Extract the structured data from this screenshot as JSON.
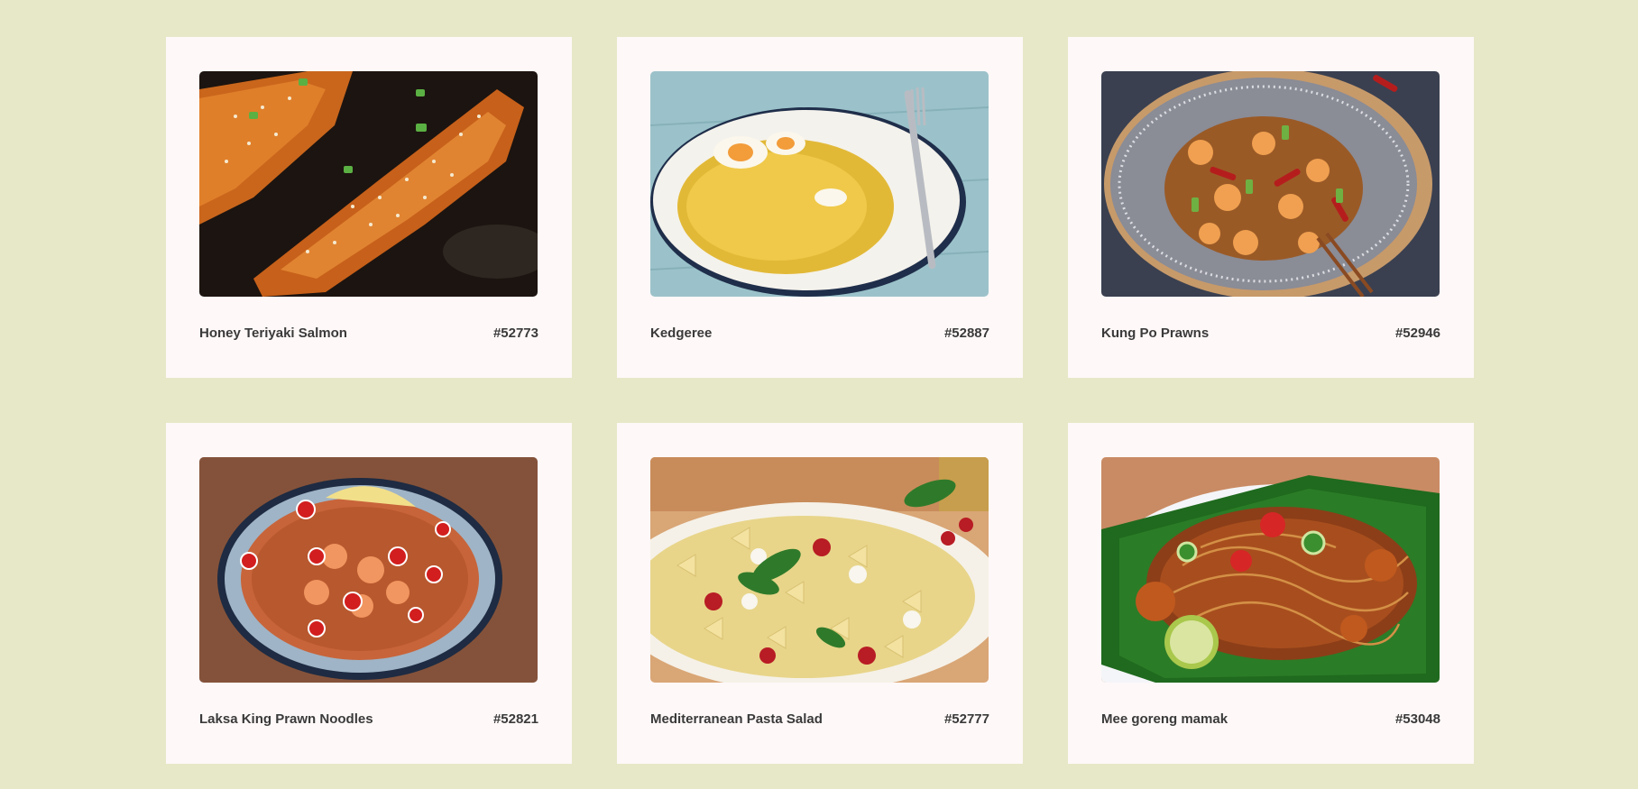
{
  "recipes": [
    {
      "name": "Honey Teriyaki Salmon",
      "id": "#52773",
      "image": "teriyaki-salmon-photo"
    },
    {
      "name": "Kedgeree",
      "id": "#52887",
      "image": "kedgeree-photo"
    },
    {
      "name": "Kung Po Prawns",
      "id": "#52946",
      "image": "kung-po-prawns-photo"
    },
    {
      "name": "Laksa King Prawn Noodles",
      "id": "#52821",
      "image": "laksa-noodles-photo"
    },
    {
      "name": "Mediterranean Pasta Salad",
      "id": "#52777",
      "image": "pasta-salad-photo"
    },
    {
      "name": "Mee goreng mamak",
      "id": "#53048",
      "image": "mee-goreng-photo"
    }
  ],
  "colors": {
    "page_background": "#e7e8c8",
    "card_background": "#fff8f8",
    "text": "#3a3a3a"
  }
}
